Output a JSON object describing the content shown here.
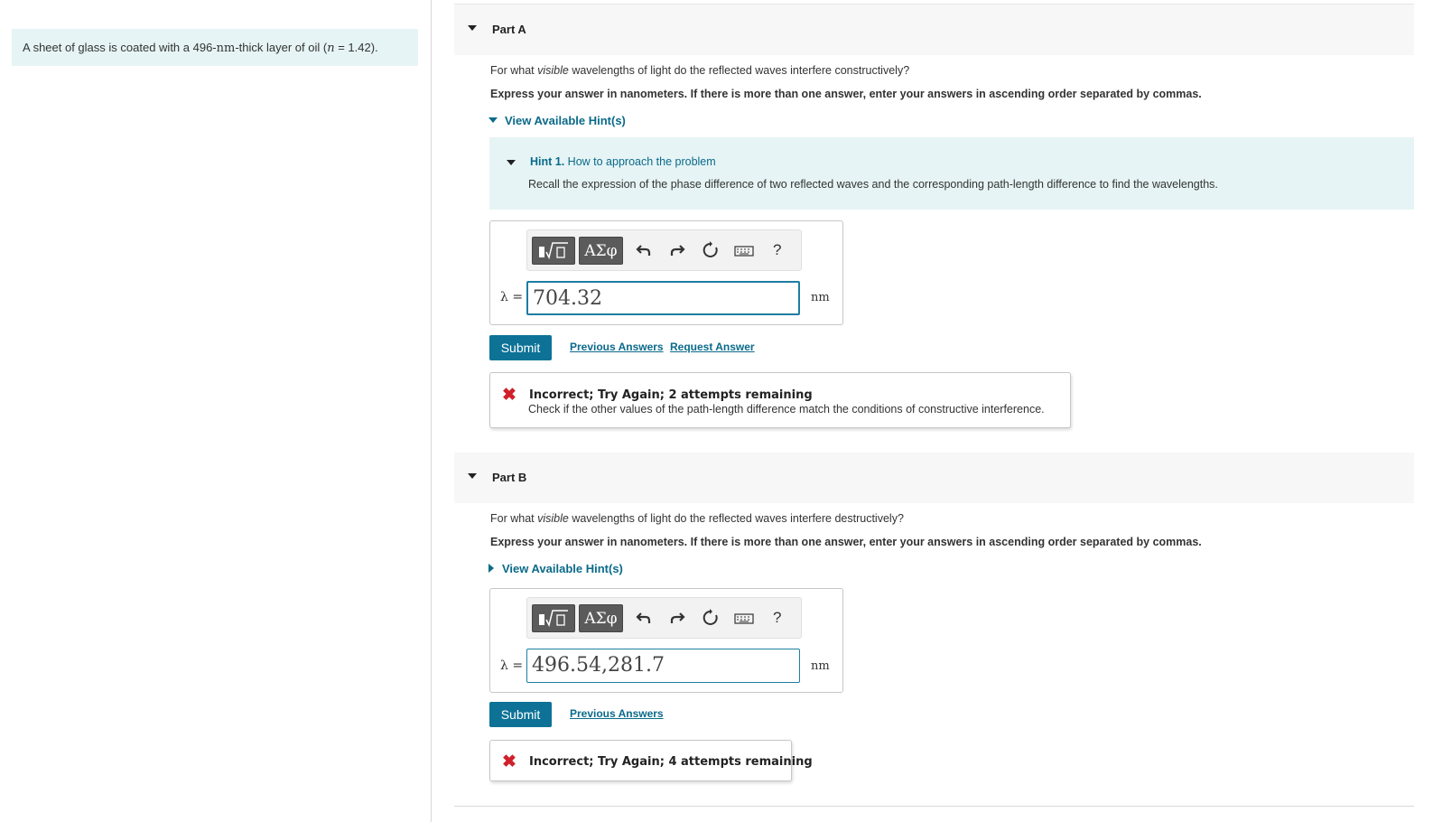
{
  "problem": {
    "text_pre": "A sheet of glass is coated with a 496-",
    "unit": "nm",
    "text_mid": "-thick layer of oil (",
    "var": "n",
    "text_post": " = 1.42)."
  },
  "parts": [
    {
      "title": "Part A",
      "question_pre": "For what ",
      "question_em": "visible",
      "question_post": " wavelengths of light do the reflected waves interfere constructively?",
      "instruction": "Express your answer in nanometers. If there is more than one answer, enter your answers in ascending order separated by commas.",
      "hint_toggle": "View Available Hint(s)",
      "hint": {
        "number": "Hint 1.",
        "title": " How to approach the problem",
        "body": "Recall the expression of the phase difference of two reflected waves and the corresponding path-length difference to find the wavelengths."
      },
      "toolbar": {
        "symbols": "ΑΣφ",
        "help": "?"
      },
      "answer_label": "λ =",
      "answer_value": "704.32",
      "unit": "nm",
      "submit": "Submit",
      "links": [
        "Previous Answers",
        "Request Answer"
      ],
      "feedback": {
        "title": "Incorrect; Try Again; 2 attempts remaining",
        "body": "Check if the other values of the path-length difference match the conditions of constructive interference."
      }
    },
    {
      "title": "Part B",
      "question_pre": "For what ",
      "question_em": "visible",
      "question_post": " wavelengths of light do the reflected waves interfere destructively?",
      "instruction": "Express your answer in nanometers. If there is more than one answer, enter your answers in ascending order separated by commas.",
      "hint_toggle": "View Available Hint(s)",
      "toolbar": {
        "symbols": "ΑΣφ",
        "help": "?"
      },
      "answer_label": "λ =",
      "answer_value": "496.54,281.7",
      "unit": "nm",
      "submit": "Submit",
      "links": [
        "Previous Answers"
      ],
      "feedback": {
        "title": "Incorrect; Try Again; 4 attempts remaining"
      }
    }
  ],
  "colors": {
    "accent": "#0d7296",
    "link": "#0a6a8a",
    "hint_bg": "#e6f4f5",
    "error": "#d0202a"
  }
}
